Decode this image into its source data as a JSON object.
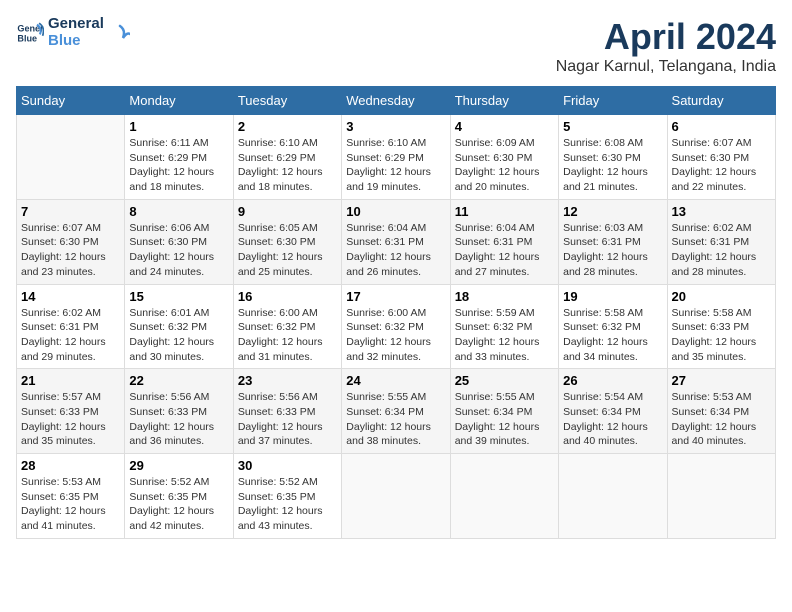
{
  "header": {
    "logo_line1": "General",
    "logo_line2": "Blue",
    "month": "April 2024",
    "location": "Nagar Karnul, Telangana, India"
  },
  "weekdays": [
    "Sunday",
    "Monday",
    "Tuesday",
    "Wednesday",
    "Thursday",
    "Friday",
    "Saturday"
  ],
  "weeks": [
    [
      {
        "day": "",
        "sunrise": "",
        "sunset": "",
        "daylight": ""
      },
      {
        "day": "1",
        "sunrise": "Sunrise: 6:11 AM",
        "sunset": "Sunset: 6:29 PM",
        "daylight": "Daylight: 12 hours and 18 minutes."
      },
      {
        "day": "2",
        "sunrise": "Sunrise: 6:10 AM",
        "sunset": "Sunset: 6:29 PM",
        "daylight": "Daylight: 12 hours and 18 minutes."
      },
      {
        "day": "3",
        "sunrise": "Sunrise: 6:10 AM",
        "sunset": "Sunset: 6:29 PM",
        "daylight": "Daylight: 12 hours and 19 minutes."
      },
      {
        "day": "4",
        "sunrise": "Sunrise: 6:09 AM",
        "sunset": "Sunset: 6:30 PM",
        "daylight": "Daylight: 12 hours and 20 minutes."
      },
      {
        "day": "5",
        "sunrise": "Sunrise: 6:08 AM",
        "sunset": "Sunset: 6:30 PM",
        "daylight": "Daylight: 12 hours and 21 minutes."
      },
      {
        "day": "6",
        "sunrise": "Sunrise: 6:07 AM",
        "sunset": "Sunset: 6:30 PM",
        "daylight": "Daylight: 12 hours and 22 minutes."
      }
    ],
    [
      {
        "day": "7",
        "sunrise": "Sunrise: 6:07 AM",
        "sunset": "Sunset: 6:30 PM",
        "daylight": "Daylight: 12 hours and 23 minutes."
      },
      {
        "day": "8",
        "sunrise": "Sunrise: 6:06 AM",
        "sunset": "Sunset: 6:30 PM",
        "daylight": "Daylight: 12 hours and 24 minutes."
      },
      {
        "day": "9",
        "sunrise": "Sunrise: 6:05 AM",
        "sunset": "Sunset: 6:30 PM",
        "daylight": "Daylight: 12 hours and 25 minutes."
      },
      {
        "day": "10",
        "sunrise": "Sunrise: 6:04 AM",
        "sunset": "Sunset: 6:31 PM",
        "daylight": "Daylight: 12 hours and 26 minutes."
      },
      {
        "day": "11",
        "sunrise": "Sunrise: 6:04 AM",
        "sunset": "Sunset: 6:31 PM",
        "daylight": "Daylight: 12 hours and 27 minutes."
      },
      {
        "day": "12",
        "sunrise": "Sunrise: 6:03 AM",
        "sunset": "Sunset: 6:31 PM",
        "daylight": "Daylight: 12 hours and 28 minutes."
      },
      {
        "day": "13",
        "sunrise": "Sunrise: 6:02 AM",
        "sunset": "Sunset: 6:31 PM",
        "daylight": "Daylight: 12 hours and 28 minutes."
      }
    ],
    [
      {
        "day": "14",
        "sunrise": "Sunrise: 6:02 AM",
        "sunset": "Sunset: 6:31 PM",
        "daylight": "Daylight: 12 hours and 29 minutes."
      },
      {
        "day": "15",
        "sunrise": "Sunrise: 6:01 AM",
        "sunset": "Sunset: 6:32 PM",
        "daylight": "Daylight: 12 hours and 30 minutes."
      },
      {
        "day": "16",
        "sunrise": "Sunrise: 6:00 AM",
        "sunset": "Sunset: 6:32 PM",
        "daylight": "Daylight: 12 hours and 31 minutes."
      },
      {
        "day": "17",
        "sunrise": "Sunrise: 6:00 AM",
        "sunset": "Sunset: 6:32 PM",
        "daylight": "Daylight: 12 hours and 32 minutes."
      },
      {
        "day": "18",
        "sunrise": "Sunrise: 5:59 AM",
        "sunset": "Sunset: 6:32 PM",
        "daylight": "Daylight: 12 hours and 33 minutes."
      },
      {
        "day": "19",
        "sunrise": "Sunrise: 5:58 AM",
        "sunset": "Sunset: 6:32 PM",
        "daylight": "Daylight: 12 hours and 34 minutes."
      },
      {
        "day": "20",
        "sunrise": "Sunrise: 5:58 AM",
        "sunset": "Sunset: 6:33 PM",
        "daylight": "Daylight: 12 hours and 35 minutes."
      }
    ],
    [
      {
        "day": "21",
        "sunrise": "Sunrise: 5:57 AM",
        "sunset": "Sunset: 6:33 PM",
        "daylight": "Daylight: 12 hours and 35 minutes."
      },
      {
        "day": "22",
        "sunrise": "Sunrise: 5:56 AM",
        "sunset": "Sunset: 6:33 PM",
        "daylight": "Daylight: 12 hours and 36 minutes."
      },
      {
        "day": "23",
        "sunrise": "Sunrise: 5:56 AM",
        "sunset": "Sunset: 6:33 PM",
        "daylight": "Daylight: 12 hours and 37 minutes."
      },
      {
        "day": "24",
        "sunrise": "Sunrise: 5:55 AM",
        "sunset": "Sunset: 6:34 PM",
        "daylight": "Daylight: 12 hours and 38 minutes."
      },
      {
        "day": "25",
        "sunrise": "Sunrise: 5:55 AM",
        "sunset": "Sunset: 6:34 PM",
        "daylight": "Daylight: 12 hours and 39 minutes."
      },
      {
        "day": "26",
        "sunrise": "Sunrise: 5:54 AM",
        "sunset": "Sunset: 6:34 PM",
        "daylight": "Daylight: 12 hours and 40 minutes."
      },
      {
        "day": "27",
        "sunrise": "Sunrise: 5:53 AM",
        "sunset": "Sunset: 6:34 PM",
        "daylight": "Daylight: 12 hours and 40 minutes."
      }
    ],
    [
      {
        "day": "28",
        "sunrise": "Sunrise: 5:53 AM",
        "sunset": "Sunset: 6:35 PM",
        "daylight": "Daylight: 12 hours and 41 minutes."
      },
      {
        "day": "29",
        "sunrise": "Sunrise: 5:52 AM",
        "sunset": "Sunset: 6:35 PM",
        "daylight": "Daylight: 12 hours and 42 minutes."
      },
      {
        "day": "30",
        "sunrise": "Sunrise: 5:52 AM",
        "sunset": "Sunset: 6:35 PM",
        "daylight": "Daylight: 12 hours and 43 minutes."
      },
      {
        "day": "",
        "sunrise": "",
        "sunset": "",
        "daylight": ""
      },
      {
        "day": "",
        "sunrise": "",
        "sunset": "",
        "daylight": ""
      },
      {
        "day": "",
        "sunrise": "",
        "sunset": "",
        "daylight": ""
      },
      {
        "day": "",
        "sunrise": "",
        "sunset": "",
        "daylight": ""
      }
    ]
  ]
}
